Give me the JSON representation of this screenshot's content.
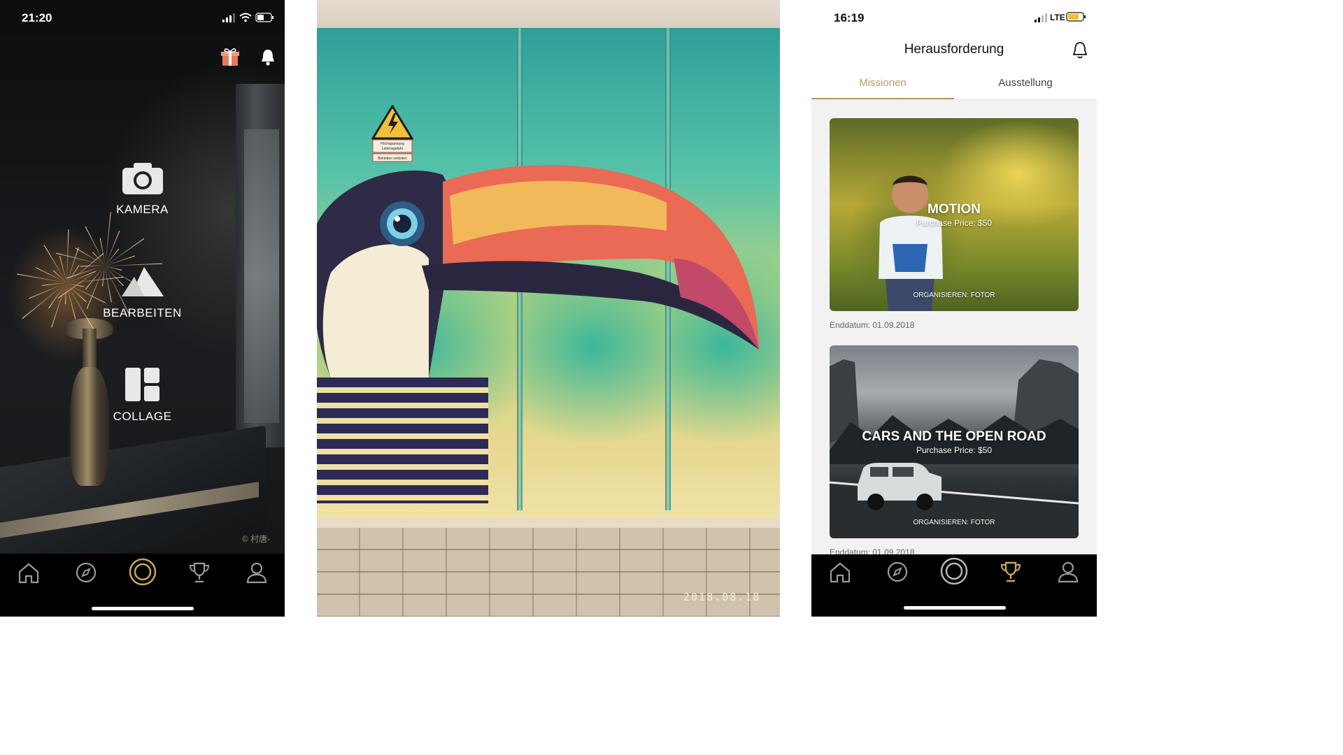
{
  "phone_left": {
    "status_time": "21:20",
    "menu": [
      {
        "label": "KAMERA",
        "icon": "camera-icon"
      },
      {
        "label": "BEARBEITEN",
        "icon": "mountain-edit-icon"
      },
      {
        "label": "COLLAGE",
        "icon": "collage-grid-icon"
      }
    ],
    "credit": "© 村唐-",
    "tabbar": [
      "home-icon",
      "compass-icon",
      "shutter-icon",
      "trophy-icon",
      "profile-icon"
    ],
    "active_tab": "shutter-icon",
    "accent": "#c9a659"
  },
  "photo_middle": {
    "date_stamp": "2018.08.18",
    "sign_lines": [
      "Hochspannung",
      "Lebensgefahr",
      "Bekleben verboten"
    ]
  },
  "phone_right": {
    "status_time": "16:19",
    "network": "LTE",
    "title": "Herausforderung",
    "tabs": [
      {
        "label": "Missionen",
        "active": true
      },
      {
        "label": "Ausstellung",
        "active": false
      }
    ],
    "cards": [
      {
        "title": "MOTION",
        "price": "Purchase Price: $50",
        "organizer": "ORGANISIEREN: FOTOR",
        "end_date": "Enddatum: 01.09.2018"
      },
      {
        "title": "CARS AND THE OPEN ROAD",
        "price": "Purchase Price: $50",
        "organizer": "ORGANISIEREN: FOTOR",
        "end_date": "Enddatum: 01.09.2018"
      }
    ],
    "tabbar": [
      "home-icon",
      "compass-icon",
      "shutter-icon",
      "trophy-icon",
      "profile-icon"
    ],
    "active_tab": "trophy-icon",
    "accent": "#b79b63"
  }
}
